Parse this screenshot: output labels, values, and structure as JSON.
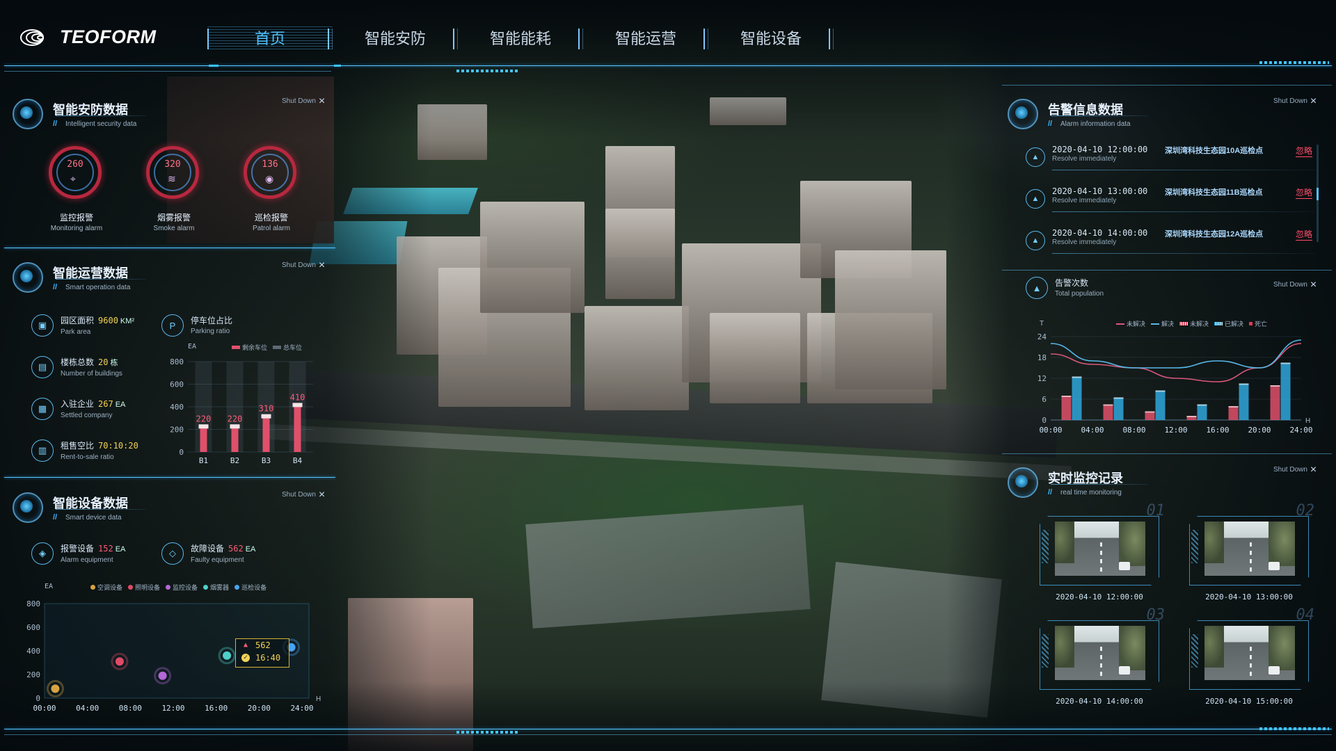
{
  "brand": {
    "name": "TEOFORM"
  },
  "nav": [
    {
      "label": "首页",
      "active": true
    },
    {
      "label": "智能安防"
    },
    {
      "label": "智能能耗"
    },
    {
      "label": "智能运营"
    },
    {
      "label": "智能设备"
    }
  ],
  "common": {
    "shut_down": "Shut Down"
  },
  "security": {
    "title": "智能安防数据",
    "subtitle": "Intelligent security data",
    "items": [
      {
        "value": "260",
        "label": "监控报警",
        "label_en": "Monitoring alarm",
        "icon": "camera-icon"
      },
      {
        "value": "320",
        "label": "烟雾报警",
        "label_en": "Smoke alarm",
        "icon": "smoke-icon"
      },
      {
        "value": "136",
        "label": "巡检报警",
        "label_en": "Patrol alarm",
        "icon": "patrol-icon"
      }
    ]
  },
  "operation": {
    "title": "智能运营数据",
    "subtitle": "Smart operation data",
    "stats": [
      {
        "label": "园区面积",
        "value": "9600",
        "unit": "KM²",
        "label_en": "Park area"
      },
      {
        "label": "楼栋总数",
        "value": "20",
        "unit": "栋",
        "label_en": "Number of buildings"
      },
      {
        "label": "入驻企业",
        "value": "267",
        "unit": "EA",
        "label_en": "Settled company"
      },
      {
        "label": "租售空比",
        "value": "70:10:20",
        "unit": "",
        "label_en": "Rent-to-sale ratio"
      }
    ],
    "parking": {
      "label": "停车位占比",
      "label_en": "Parking ratio",
      "unit": "EA",
      "legend": [
        "剩余车位",
        "总车位"
      ]
    }
  },
  "device": {
    "title": "智能设备数据",
    "subtitle": "Smart device data",
    "stats": [
      {
        "label": "报警设备",
        "value": "152",
        "unit": "EA",
        "label_en": "Alarm equipment"
      },
      {
        "label": "故障设备",
        "value": "562",
        "unit": "EA",
        "label_en": "Faulty equipment"
      }
    ],
    "unit": "EA",
    "legend": [
      "空调设备",
      "照明设备",
      "监控设备",
      "烟雾器",
      "巡检设备"
    ],
    "tooltip": {
      "value": "562",
      "time": "16:40"
    }
  },
  "alarm_info": {
    "title": "告警信息数据",
    "subtitle": "Alarm information data",
    "items": [
      {
        "time": "2020-04-10  12:00:00",
        "place": "深圳湾科技生态园10A巡检点",
        "sub": "Resolve immediately",
        "action": "忽略"
      },
      {
        "time": "2020-04-10  13:00:00",
        "place": "深圳湾科技生态园11B巡检点",
        "sub": "Resolve immediately",
        "action": "忽略"
      },
      {
        "time": "2020-04-10  14:00:00",
        "place": "深圳湾科技生态园12A巡检点",
        "sub": "Resolve immediately",
        "action": "忽略"
      }
    ]
  },
  "alarm_count": {
    "title": "告警次数",
    "subtitle": "Total population",
    "unit_y": "T",
    "unit_x": "H",
    "legend": [
      "未解决",
      "解决",
      "未解决",
      "已解决",
      "死亡"
    ]
  },
  "monitoring": {
    "title": "实时监控记录",
    "subtitle": "real time monitoring",
    "cams": [
      {
        "num": "01",
        "time": "2020-04-10  12:00:00"
      },
      {
        "num": "02",
        "time": "2020-04-10  13:00:00"
      },
      {
        "num": "03",
        "time": "2020-04-10  14:00:00"
      },
      {
        "num": "04",
        "time": "2020-04-10  15:00:00"
      }
    ]
  },
  "chart_data": [
    {
      "type": "bar",
      "title": "停车位占比",
      "ylabel": "EA",
      "categories": [
        "B1",
        "B2",
        "B3",
        "B4"
      ],
      "yticks": [
        0,
        200,
        400,
        600,
        800
      ],
      "ylim": [
        0,
        800
      ],
      "series": [
        {
          "name": "剩余车位",
          "values": [
            220,
            220,
            310,
            410
          ]
        }
      ],
      "data_labels": [
        "220",
        "220",
        "310",
        "410"
      ]
    },
    {
      "type": "scatter",
      "ylabel": "EA",
      "xlabel": "H",
      "x_ticks": [
        "00:00",
        "04:00",
        "08:00",
        "12:00",
        "16:00",
        "20:00",
        "24:00"
      ],
      "yticks": [
        0,
        200,
        400,
        600,
        800
      ],
      "ylim": [
        0,
        800
      ],
      "xlim": [
        0,
        24
      ],
      "series": [
        {
          "name": "空调设备",
          "color": "#d8a340",
          "points": [
            [
              1,
              80
            ]
          ]
        },
        {
          "name": "照明设备",
          "color": "#e04a66",
          "points": [
            [
              7,
              310
            ]
          ]
        },
        {
          "name": "监控设备",
          "color": "#b467d8",
          "points": [
            [
              11,
              190
            ]
          ]
        },
        {
          "name": "烟雾器",
          "color": "#4fd0c9",
          "points": [
            [
              17,
              360
            ]
          ]
        },
        {
          "name": "巡检设备",
          "color": "#4aa4f0",
          "points": [
            [
              23,
              430
            ]
          ]
        }
      ]
    },
    {
      "type": "bar",
      "title": "告警次数",
      "ylabel": "T",
      "xlabel": "H",
      "x_ticks": [
        "00:00",
        "04:00",
        "08:00",
        "12:00",
        "16:00",
        "20:00",
        "24:00"
      ],
      "yticks": [
        0,
        6,
        12,
        18,
        24
      ],
      "ylim": [
        0,
        24
      ],
      "xlim": [
        0,
        24
      ],
      "series": [
        {
          "name": "未解决",
          "type": "bar",
          "color": "#e0506a",
          "x": [
            1.5,
            5.5,
            9.5,
            13.5,
            17.5,
            21.5
          ],
          "values": [
            7,
            4.5,
            2.5,
            1.2,
            4,
            10
          ]
        },
        {
          "name": "已解决",
          "type": "bar",
          "color": "#2fa7dc",
          "x": [
            2.5,
            6.5,
            10.5,
            14.5,
            18.5,
            22.5
          ],
          "values": [
            12.5,
            6.5,
            8.5,
            4.5,
            10.5,
            16.5
          ]
        },
        {
          "name": "未解决",
          "type": "line",
          "color": "#d9577a",
          "x": [
            0,
            4,
            8,
            12,
            16,
            20,
            24
          ],
          "values": [
            19,
            16,
            15,
            12,
            11,
            15,
            22
          ]
        },
        {
          "name": "解决",
          "type": "line",
          "color": "#58b8e8",
          "x": [
            0,
            4,
            8,
            12,
            16,
            20,
            24
          ],
          "values": [
            22,
            17,
            15,
            15,
            17,
            15,
            23
          ]
        }
      ]
    }
  ]
}
